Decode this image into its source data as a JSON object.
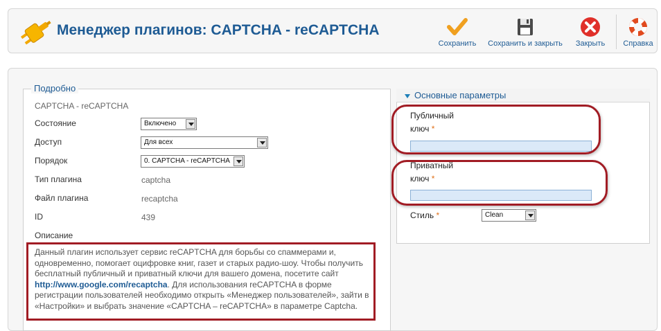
{
  "header": {
    "title": "Менеджер плагинов: CAPTCHA - reCAPTCHA",
    "buttons": {
      "save": "Сохранить",
      "save_close": "Сохранить и закрыть",
      "close": "Закрыть",
      "help": "Справка"
    }
  },
  "details": {
    "legend": "Подробно",
    "plugin_name": "CAPTCHA - reCAPTCHA",
    "state_label": "Состояние",
    "state_value": "Включено",
    "access_label": "Доступ",
    "access_value": "Для всех",
    "order_label": "Порядок",
    "order_value": "0. CAPTCHA - reCAPTCHA",
    "type_label": "Тип плагина",
    "type_value": "captcha",
    "file_label": "Файл плагина",
    "file_value": "recaptcha",
    "id_label": "ID",
    "id_value": "439",
    "description_label": "Описание",
    "description_part1": "Данный плагин использует сервис reCAPTCHA для борьбы со спаммерами и, одновременно, помогает оцифровке книг, газет и старых радио-шоу. Чтобы получить бесплатный публичный и приватный ключи для вашего домена, посетите сайт ",
    "description_link": "http://www.google.com/recaptcha",
    "description_part2": ". Для использования reCAPTCHA в форме регистрации пользователей необходимо открыть «Менеджер пользователей», зайти в «Настройки» и выбрать значение «CAPTCHA – reCAPTCHA» в параметре Captcha."
  },
  "params": {
    "title": "Основные параметры",
    "public_key_label_1": "Публичный",
    "public_key_label_2": "ключ",
    "public_key_value": "",
    "private_key_label_1": "Приватный",
    "private_key_label_2": "ключ",
    "private_key_value": "",
    "style_label": "Стиль",
    "style_value": "Clean",
    "required_mark": "*"
  }
}
